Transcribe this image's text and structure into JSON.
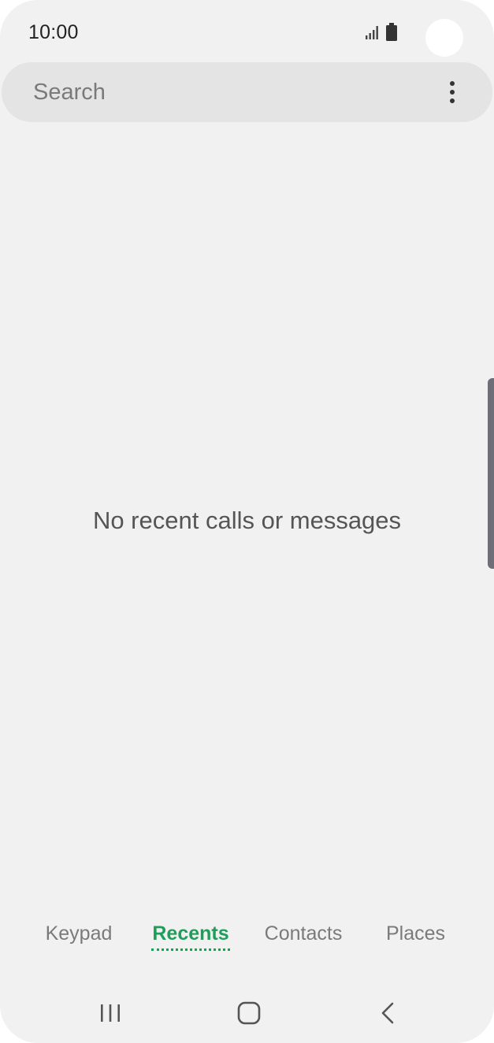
{
  "status_bar": {
    "time": "10:00"
  },
  "search": {
    "placeholder": "Search"
  },
  "empty_state": {
    "message": "No recent calls or messages"
  },
  "tabs": [
    {
      "label": "Keypad",
      "active": false
    },
    {
      "label": "Recents",
      "active": true
    },
    {
      "label": "Contacts",
      "active": false
    },
    {
      "label": "Places",
      "active": false
    }
  ],
  "icons": {
    "signal": "signal-icon",
    "battery": "battery-icon",
    "more": "more-options-icon",
    "recent_apps": "recent-apps-icon",
    "home": "home-icon",
    "back": "back-icon"
  },
  "colors": {
    "accent": "#1e9e5a",
    "background": "#f1f1f1",
    "search_background": "#e4e4e4"
  }
}
